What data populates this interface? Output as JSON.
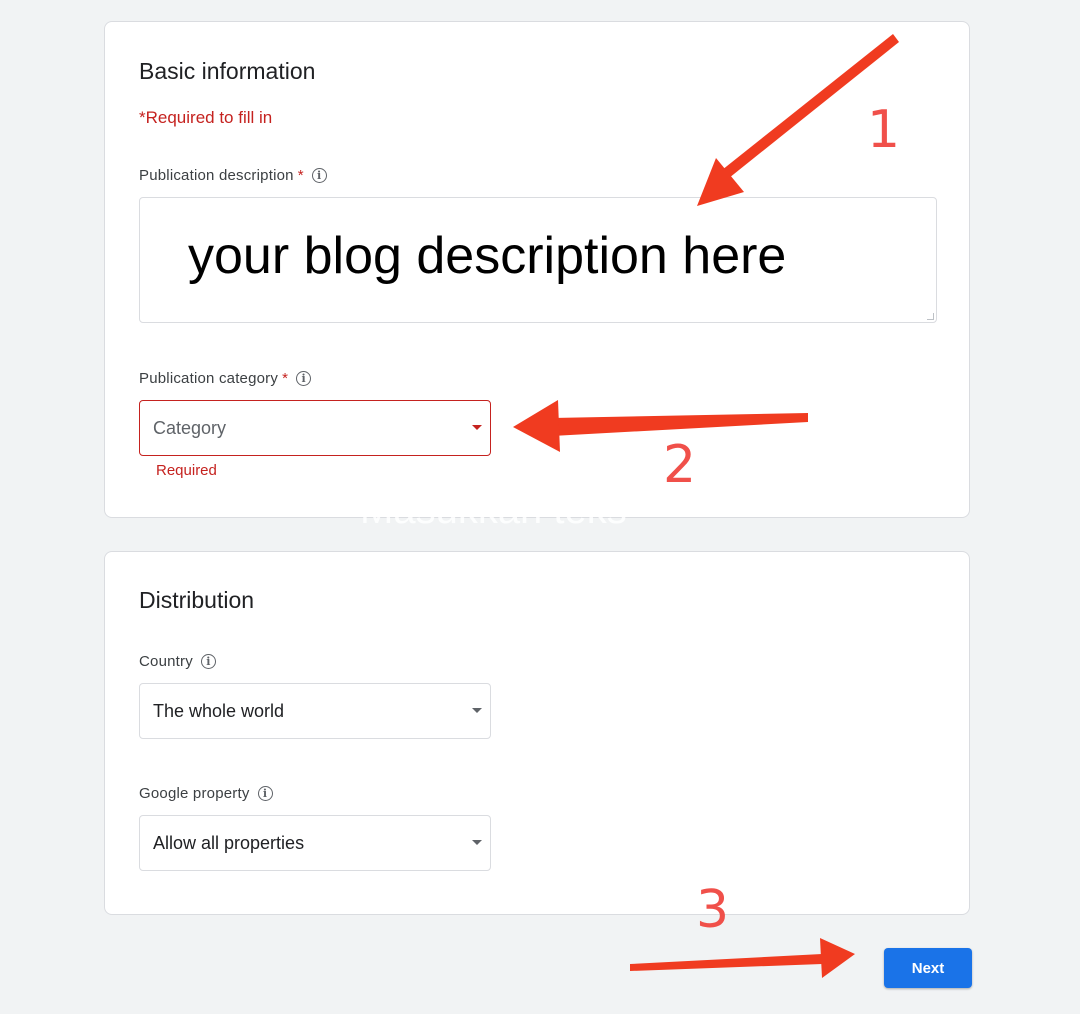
{
  "basic_info": {
    "title": "Basic information",
    "required_note": "*Required to fill in",
    "description_label": "Publication description",
    "required_star": "*",
    "description_value": "your blog description here",
    "category_label": "Publication category",
    "category_placeholder": "Category",
    "category_error": "Required"
  },
  "distribution": {
    "title": "Distribution",
    "country_label": "Country",
    "country_value": "The whole world",
    "property_label": "Google property",
    "property_value": "Allow all properties"
  },
  "actions": {
    "next_label": "Next"
  },
  "annotations": {
    "step1": "1",
    "step2": "2",
    "step3": "3",
    "arrow_color": "#f03b20"
  },
  "watermark": "Masukkan teks",
  "colors": {
    "accent": "#1a73e8",
    "error": "#c5221f",
    "annotation": "#f0504a"
  }
}
